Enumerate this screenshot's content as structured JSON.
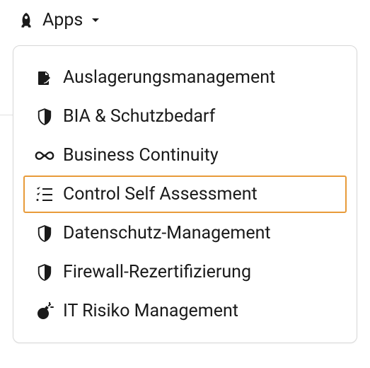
{
  "header": {
    "label": "Apps"
  },
  "menu": {
    "items": [
      {
        "icon": "document-edit-icon",
        "label": "Auslagerungsmanagement",
        "highlighted": false
      },
      {
        "icon": "shield-icon",
        "label": "BIA & Schutzbedarf",
        "highlighted": false
      },
      {
        "icon": "infinity-icon",
        "label": "Business Continuity",
        "highlighted": false
      },
      {
        "icon": "checklist-icon",
        "label": "Control Self Assessment",
        "highlighted": true
      },
      {
        "icon": "shield-icon",
        "label": "Datenschutz-Management",
        "highlighted": false
      },
      {
        "icon": "shield-icon",
        "label": "Firewall-Rezertifizierung",
        "highlighted": false
      },
      {
        "icon": "bomb-icon",
        "label": "IT Risiko Management",
        "highlighted": false
      }
    ]
  },
  "colors": {
    "highlight": "#e89b3a",
    "text": "#1a1a1a",
    "border": "#d8d8d8"
  }
}
